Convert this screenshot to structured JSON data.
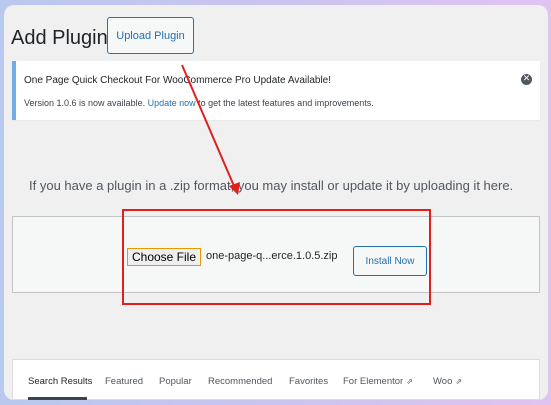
{
  "header": {
    "title": "Add Plugins",
    "upload_label": "Upload Plugin"
  },
  "notice": {
    "title": "One Page Quick Checkout For WooCommerce Pro Update Available!",
    "text_before": "Version 1.0.6 is now available. ",
    "link_text": "Update now",
    "text_after": " to get the latest features and improvements.",
    "dismiss_icon": "close-circle-icon"
  },
  "upload": {
    "instruction": "If you have a plugin in a .zip format, you may install or update it by uploading it here.",
    "choose_file_label": "Choose File",
    "filename": "one-page-q...erce.1.0.5.zip",
    "install_label": "Install Now"
  },
  "tabs": [
    {
      "label": "Search Results",
      "current": true
    },
    {
      "label": "Featured",
      "current": false
    },
    {
      "label": "Popular",
      "current": false
    },
    {
      "label": "Recommended",
      "current": false
    },
    {
      "label": "Favorites",
      "current": false
    },
    {
      "label": "For Elementor",
      "current": false,
      "external": true
    },
    {
      "label": "Woo",
      "current": false,
      "external": true
    }
  ],
  "colors": {
    "accent": "#2271b1",
    "annotation": "#e0201f",
    "notice_border": "#72aee6",
    "choose_file_border": "#e59b00"
  }
}
